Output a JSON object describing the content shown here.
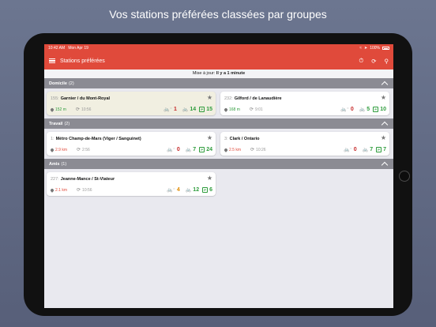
{
  "caption": "Vos stations préférées classées par groupes",
  "statusbar": {
    "time": "10:42 AM",
    "date": "Mon Apr 19",
    "battery": "100%"
  },
  "navbar": {
    "title": "Stations préférées",
    "icons": {
      "menu": "hamburger-icon",
      "timer": "stopwatch-icon",
      "refresh": "refresh-icon",
      "search": "search-icon"
    }
  },
  "update": {
    "label": "Mise à jour:",
    "value": "Il y a 1 minute"
  },
  "groups": [
    {
      "name": "Domicile",
      "count": "(2)",
      "stations": [
        {
          "num": "155:",
          "name": "Garnier / du Mont-Royal",
          "distance": "152 m",
          "distance_color": "green",
          "time": "10:56",
          "ebike": "1",
          "ebike_color": "red",
          "bikes": "14",
          "bikes_color": "green",
          "docks": "15",
          "docks_color": "green"
        },
        {
          "num": "232:",
          "name": "Gilford / de Lanaudière",
          "distance": "168 m",
          "distance_color": "green",
          "time": "9:01",
          "ebike": "0",
          "ebike_color": "red",
          "bikes": "5",
          "bikes_color": "green",
          "docks": "10",
          "docks_color": "green"
        }
      ]
    },
    {
      "name": "Travail",
      "count": "(2)",
      "stations": [
        {
          "num": "1:",
          "name": "Métro Champ-de-Mars (Viger / Sanguinet)",
          "distance": "2.9 km",
          "distance_color": "red",
          "time": "2:56",
          "ebike": "0",
          "ebike_color": "red",
          "bikes": "7",
          "bikes_color": "green",
          "docks": "24",
          "docks_color": "green"
        },
        {
          "num": "3:",
          "name": "Clark / Ontario",
          "distance": "2.5 km",
          "distance_color": "red",
          "time": "10:26",
          "ebike": "0",
          "ebike_color": "red",
          "bikes": "7",
          "bikes_color": "green",
          "docks": "7",
          "docks_color": "green"
        }
      ]
    },
    {
      "name": "Amis",
      "count": "(1)",
      "stations": [
        {
          "num": "227:",
          "name": "Jeanne-Mance / St-Viateur",
          "distance": "2.1 km",
          "distance_color": "red",
          "time": "10:56",
          "ebike": "4",
          "ebike_color": "orange",
          "bikes": "12",
          "bikes_color": "green",
          "docks": "6",
          "docks_color": "green"
        }
      ]
    }
  ],
  "colors": {
    "accent": "#e04a3b",
    "group_header": "#8b8b93",
    "green": "#2e9c3c",
    "red": "#c62828",
    "orange": "#e08a00"
  }
}
